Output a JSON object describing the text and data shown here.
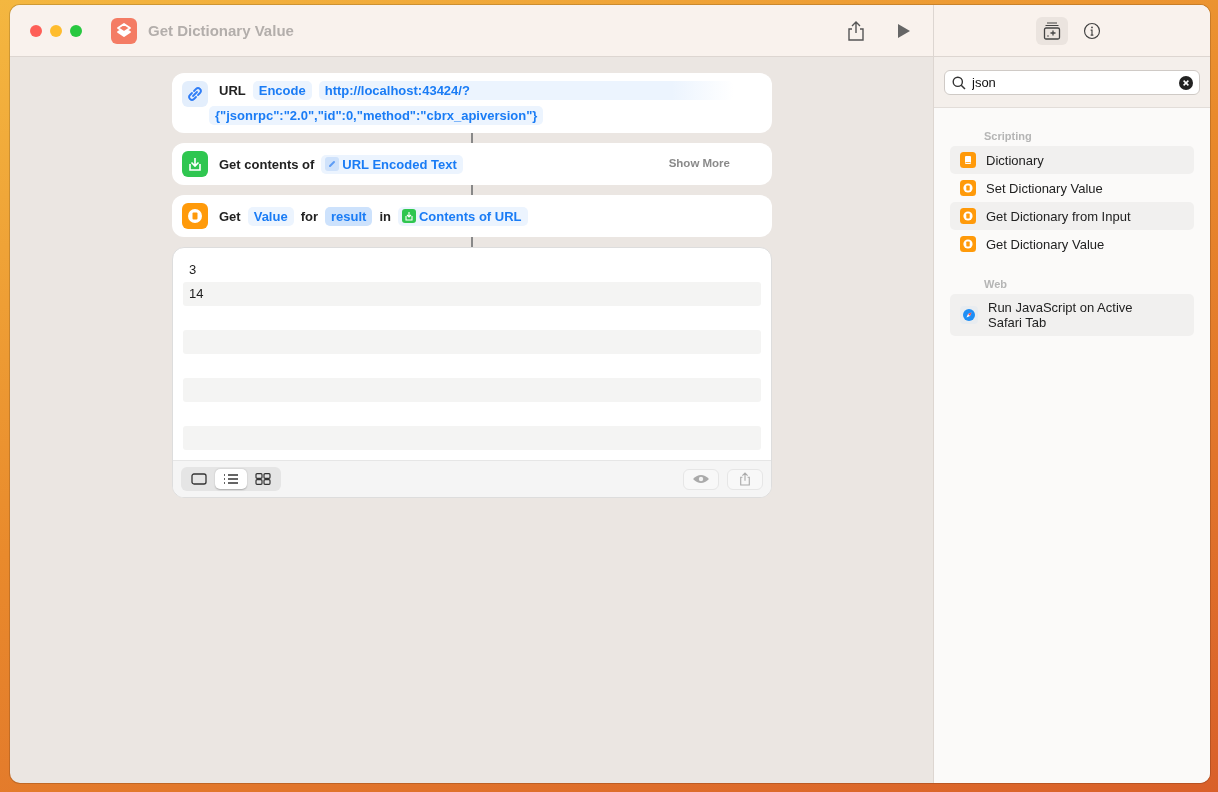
{
  "window": {
    "title": "Get Dictionary Value"
  },
  "actions": [
    {
      "kind": "url",
      "parts": [
        {
          "kind": "text",
          "text": "URL"
        },
        {
          "kind": "param",
          "text": "Encode",
          "highlighted": false
        },
        {
          "kind": "url",
          "lines": [
            "http://localhost:43424/?",
            "{\"jsonrpc\":\"2.0\",\"id\":0,\"method\":\"cbrx_apiversion\"}"
          ]
        }
      ]
    },
    {
      "kind": "get-contents",
      "parts": [
        {
          "kind": "text",
          "text": "Get contents of"
        },
        {
          "kind": "link-variable",
          "text": "URL Encoded Text"
        }
      ],
      "more": "Show More"
    },
    {
      "kind": "get-value",
      "parts": [
        {
          "kind": "text",
          "text": "Get"
        },
        {
          "kind": "param",
          "text": "Value",
          "highlighted": false
        },
        {
          "kind": "text",
          "text": "for"
        },
        {
          "kind": "param",
          "text": "result",
          "highlighted": true
        },
        {
          "kind": "text",
          "text": "in"
        },
        {
          "kind": "download-variable",
          "text": "Contents of URL"
        }
      ]
    }
  ],
  "result": {
    "rows": [
      "3",
      "14"
    ],
    "view_modes": [
      {
        "kind": "single",
        "selected": false
      },
      {
        "kind": "list",
        "selected": true
      },
      {
        "kind": "grid",
        "selected": false
      }
    ]
  },
  "sidebar": {
    "tabs": [
      {
        "kind": "library",
        "selected": true
      },
      {
        "kind": "info",
        "selected": false
      }
    ],
    "search": {
      "value": "json"
    },
    "sections": [
      {
        "title": "Scripting",
        "items": [
          {
            "label": "Dictionary",
            "kind": "dictionary"
          },
          {
            "label": "Set Dictionary Value",
            "kind": "action"
          },
          {
            "label": "Get Dictionary from Input",
            "kind": "action"
          },
          {
            "label": "Get Dictionary Value",
            "kind": "action"
          }
        ]
      },
      {
        "title": "Web",
        "items": [
          {
            "label": "Run JavaScript on Active Safari Tab",
            "kind": "safari"
          }
        ]
      }
    ]
  }
}
